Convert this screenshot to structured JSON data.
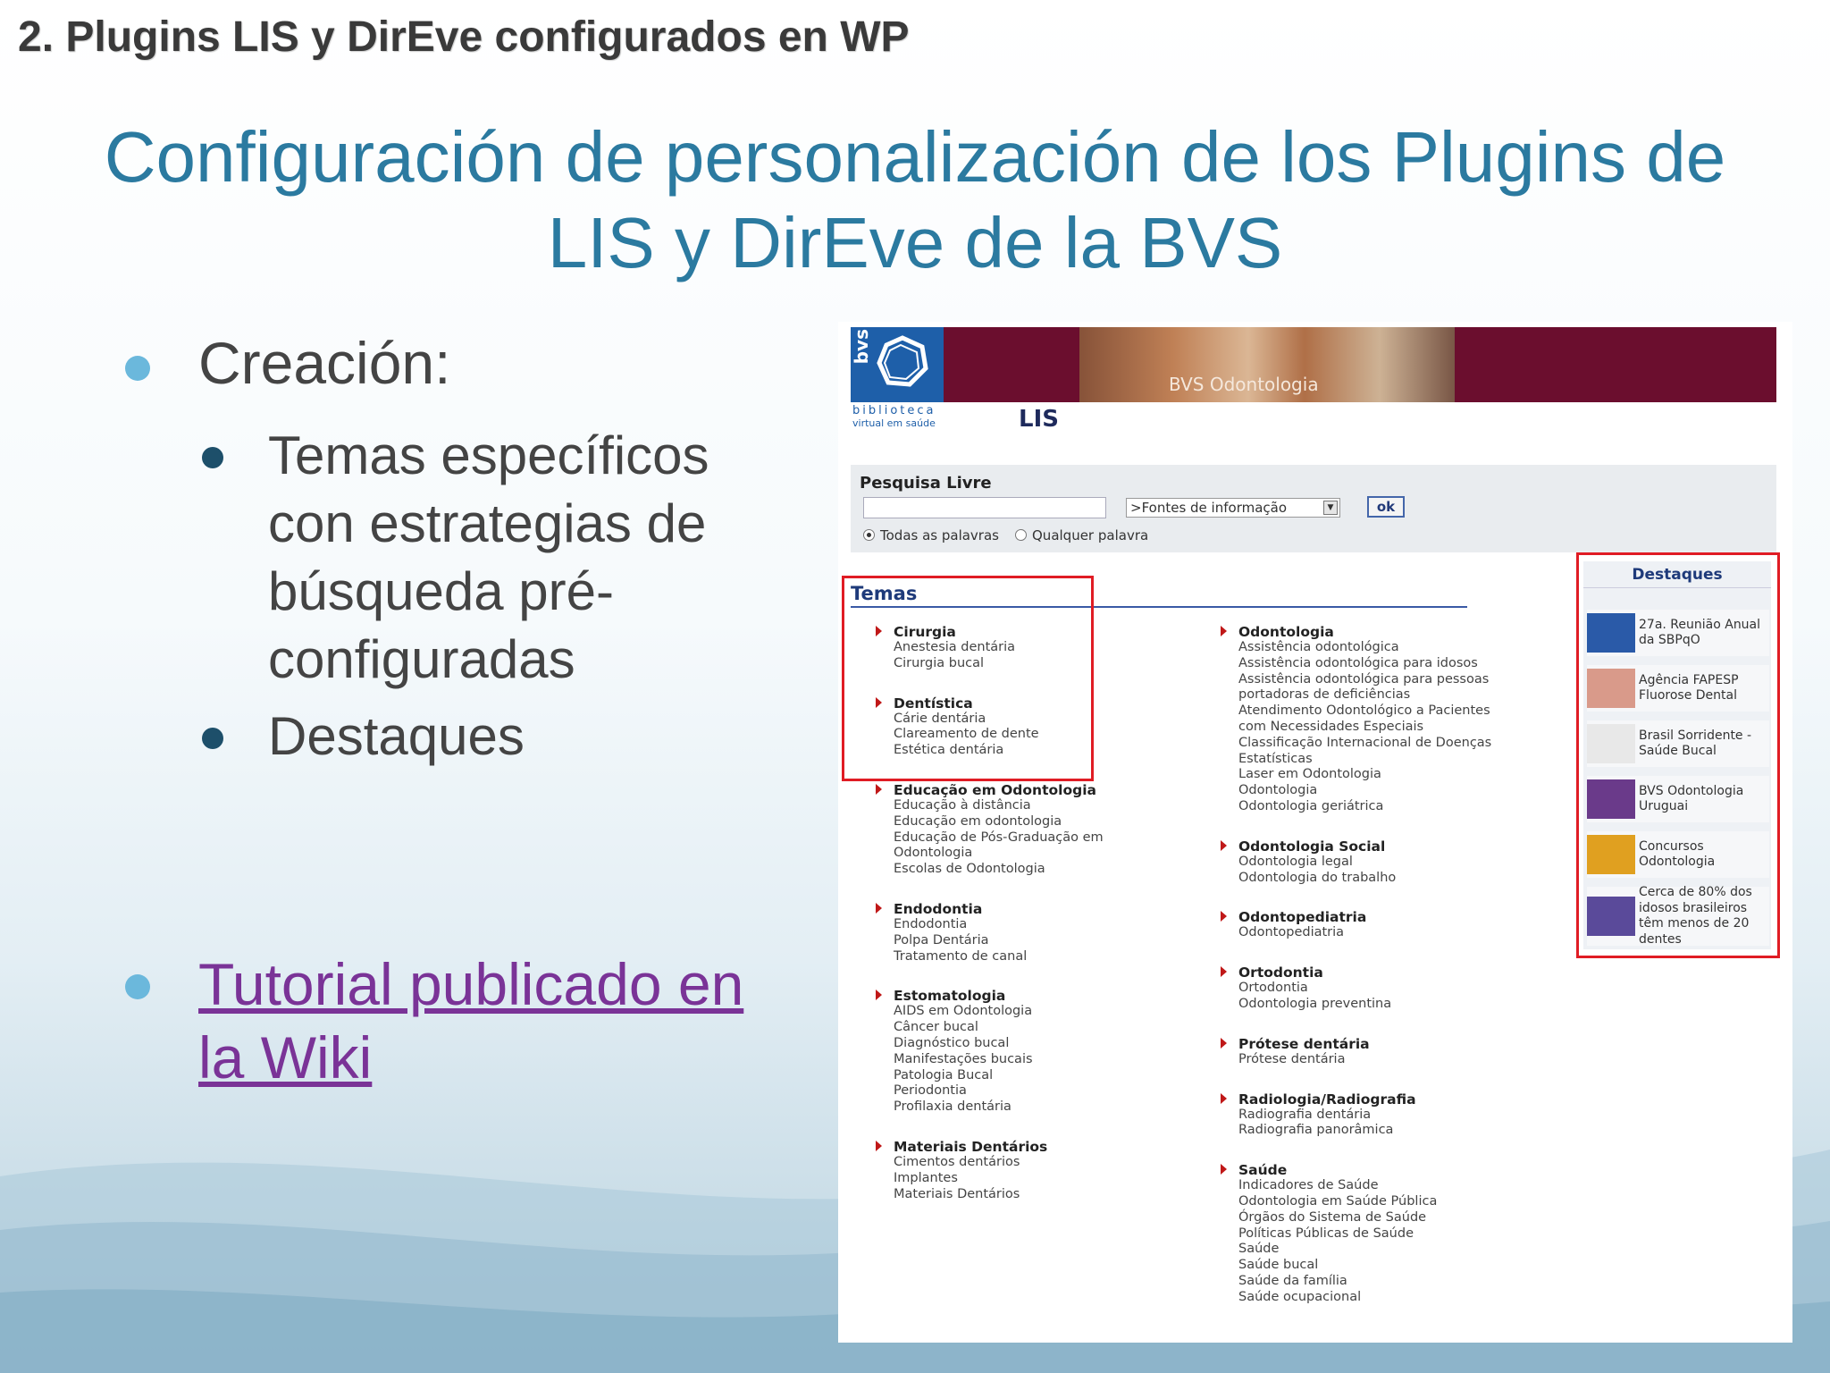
{
  "header": "2. Plugins LIS y DirEve configurados en WP",
  "title": "Configuración de personalización de los Plugins de LIS y DirEve de la BVS",
  "bullets": {
    "creacion": "Creación:",
    "temas": "Temas específicos con estrategias de búsqueda pré-configuradas",
    "destaques": "Destaques",
    "tutorial": "Tutorial publicado en la Wiki"
  },
  "screenshot": {
    "logo_vertical": "bvs",
    "logo_line1": "biblioteca",
    "logo_line2": "virtual em saúde",
    "banner_label": "BVS Odontologia",
    "page_title": "LIS",
    "search": {
      "label": "Pesquisa Livre",
      "select_value": ">Fontes de informação",
      "ok": "ok",
      "radio_all": "Todas as palavras",
      "radio_any": "Qualquer palavra"
    },
    "temas_heading": "Temas",
    "col_left": [
      {
        "name": "Cirurgia",
        "items": [
          "Anestesia dentária",
          "Cirurgia bucal"
        ]
      },
      {
        "name": "Dentística",
        "items": [
          "Cárie dentária",
          "Clareamento de dente",
          "Estética dentária"
        ]
      },
      {
        "name": "Educação em Odontologia",
        "items": [
          "Educação à distância",
          "Educação em odontologia",
          "Educação de Pós-Graduação em",
          "Odontologia",
          "Escolas de Odontologia"
        ]
      },
      {
        "name": "Endodontia",
        "items": [
          "Endodontia",
          "Polpa Dentária",
          "Tratamento de canal"
        ]
      },
      {
        "name": "Estomatologia",
        "items": [
          "AIDS em Odontologia",
          "Câncer bucal",
          "Diagnóstico bucal",
          "Manifestações bucais",
          "Patologia Bucal",
          "Periodontia",
          "Profilaxia dentária"
        ]
      },
      {
        "name": "Materiais Dentários",
        "items": [
          "Cimentos dentários",
          "Implantes",
          "Materiais Dentários"
        ]
      }
    ],
    "col_right": [
      {
        "name": "Odontologia",
        "items": [
          "Assistência odontológica",
          "Assistência odontológica para idosos",
          "Assistência odontológica para pessoas",
          "portadoras de deficiências",
          "Atendimento Odontológico a Pacientes",
          "com Necessidades Especiais",
          "Classificação Internacional de Doenças",
          "Estatísticas",
          "Laser em Odontologia",
          "Odontologia",
          "Odontologia geriátrica"
        ]
      },
      {
        "name": "Odontologia Social",
        "items": [
          "Odontologia legal",
          "Odontologia do trabalho"
        ]
      },
      {
        "name": "Odontopediatria",
        "items": [
          "Odontopediatria"
        ]
      },
      {
        "name": "Ortodontia",
        "items": [
          "Ortodontia",
          "Odontologia preventina"
        ]
      },
      {
        "name": "Prótese dentária",
        "items": [
          "Prótese dentária"
        ]
      },
      {
        "name": "Radiologia/Radiografia",
        "items": [
          "Radiografia dentária",
          "Radiografia panorâmica"
        ]
      },
      {
        "name": "Saúde",
        "items": [
          "Indicadores de Saúde",
          "Odontologia em Saúde Pública",
          "Órgãos do Sistema de Saúde",
          "Políticas Públicas de Saúde",
          "Saúde",
          "Saúde bucal",
          "Saúde da família",
          "Saúde ocupacional"
        ]
      }
    ],
    "destaques": {
      "heading": "Destaques",
      "items": [
        {
          "text": "27a. Reunião Anual da SBPqO",
          "icon": "sbpqo-logo",
          "color": "#2a5aa8"
        },
        {
          "text": "Agência FAPESP Fluorose Dental",
          "icon": "teeth-photo",
          "color": "#d99a8a"
        },
        {
          "text": "Brasil Sorridente - Saúde Bucal",
          "icon": "broken-image-icon",
          "color": "#e8e8e8"
        },
        {
          "text": "BVS Odontologia Uruguai",
          "icon": "bvs-uruguai-logo",
          "color": "#6a3a8a"
        },
        {
          "text": "Concursos Odontologia",
          "icon": "concursos-logo",
          "color": "#e0a020"
        },
        {
          "text": "Cerca de 80% dos idosos brasileiros têm menos de 20 dentes",
          "icon": "chart-thumbnail",
          "color": "#5a4a9a"
        }
      ]
    }
  }
}
